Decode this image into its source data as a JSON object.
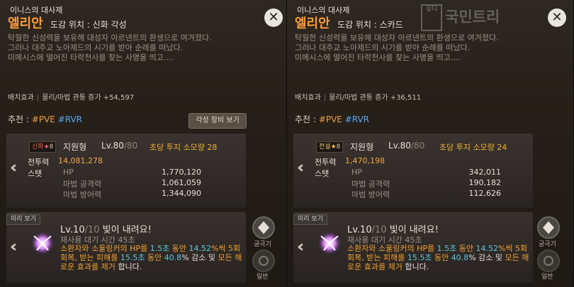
{
  "panels": [
    {
      "subtitle": "이니스의 대사제",
      "name": "엘리안",
      "location_label": "도감 위치 : 신화 각성",
      "description": [
        "탁월한 신성력을 보유해 대성자 아르넨트의 환생으로 여겨졌다.",
        "그러나 대주교 노아제드의 시기를 받아 순례를 떠났다.",
        "미메시스에 떨어진 타락천사를 찾는 사명을 띄고…."
      ],
      "placement_label": "배치효과",
      "placement_effect": "물리/마법 관통 증가 +54,597",
      "recommend_label": "추천 :",
      "rec_pve": "#PVE",
      "rec_rvr": "#RVR",
      "gear_button": "각성 장비 보기",
      "grade_word": "신화",
      "grade_star": "★",
      "grade_num": "8",
      "type": "지원형",
      "level": "Lv.80",
      "level_max": "/80",
      "cost": "초당 투지 소모량 28",
      "cp_label": "전투력",
      "cp_value": "14,081,278",
      "stat_label": "스탯",
      "stats": [
        {
          "label": "HP",
          "value": "1,770,120"
        },
        {
          "label": "마법 공격력",
          "value": "1,061,059"
        },
        {
          "label": "마법 방어력",
          "value": "1,344,090"
        }
      ],
      "preview_label": "미리 보기",
      "skill_level": "Lv.10",
      "skill_level_max": "/10",
      "skill_name": "빛이 내려요!",
      "skill_cool": "재사용 대기 시간 45초",
      "desc_a": "소환자와 소울링커의 HP를 ",
      "desc_b": "1.5초",
      "desc_c": " 동안 ",
      "desc_d": "14.52",
      "desc_e": "%씩 5회 회복, 받는 피해를 ",
      "desc_f": "15.5초",
      "desc_g": " 동안 ",
      "desc_h": "40.8",
      "desc_i": "% 감소 및 ",
      "desc_j": "모든 해로운 효과를 제거",
      "desc_k": " 합니다.",
      "ult_label": "궁극기",
      "normal_label": "일반"
    },
    {
      "subtitle": "이니스의 대사제",
      "name": "엘리안",
      "location_label": "도감 위치 : 스카드",
      "description": [
        "탁월한 신성력을 보유해 대성자 아르넨트의 환생으로 여겨졌다.",
        "그러나 대주교 노아제드의 시기를 받아 순례를 떠났다.",
        "미메시스에 떨어진 타락천사를 찾는 사명을 띄고…."
      ],
      "placement_label": "배치효과",
      "placement_effect": "물리/마법 관통 증가 +36,511",
      "recommend_label": "추천 :",
      "rec_pve": "#PVE",
      "rec_rvr": "#RVR",
      "grade_word": "전설",
      "grade_star": "★",
      "grade_num": "8",
      "type": "지원형",
      "level": "Lv.80",
      "level_max": "/80",
      "cost": "초당 투지 소모량 24",
      "cp_label": "전투력",
      "cp_value": "1,470,198",
      "stat_label": "스탯",
      "stats": [
        {
          "label": "HP",
          "value": "342,011"
        },
        {
          "label": "마법 공격력",
          "value": "190,182"
        },
        {
          "label": "마법 방어력",
          "value": "112,626"
        }
      ],
      "preview_label": "미리 보기",
      "skill_level": "Lv.10",
      "skill_level_max": "/10",
      "skill_name": "빛이 내려요!",
      "skill_cool": "재사용 대기 시간 45초",
      "desc_a": "소환자와 소울링커의 HP를 ",
      "desc_b": "1.5초",
      "desc_c": " 동안 ",
      "desc_d": "14.52",
      "desc_e": "%씩 5회 회복, 받는 피해를 ",
      "desc_f": "15.5초",
      "desc_g": " 동안 ",
      "desc_h": "40.8",
      "desc_i": "% 감소 및 ",
      "desc_j": "모든 해로운 효과를 제거",
      "desc_k": " 합니다.",
      "ult_label": "궁극기",
      "normal_label": "일반"
    }
  ],
  "close_glyph": "✕",
  "watermark": "국민트리",
  "watermark_box": "깊디"
}
